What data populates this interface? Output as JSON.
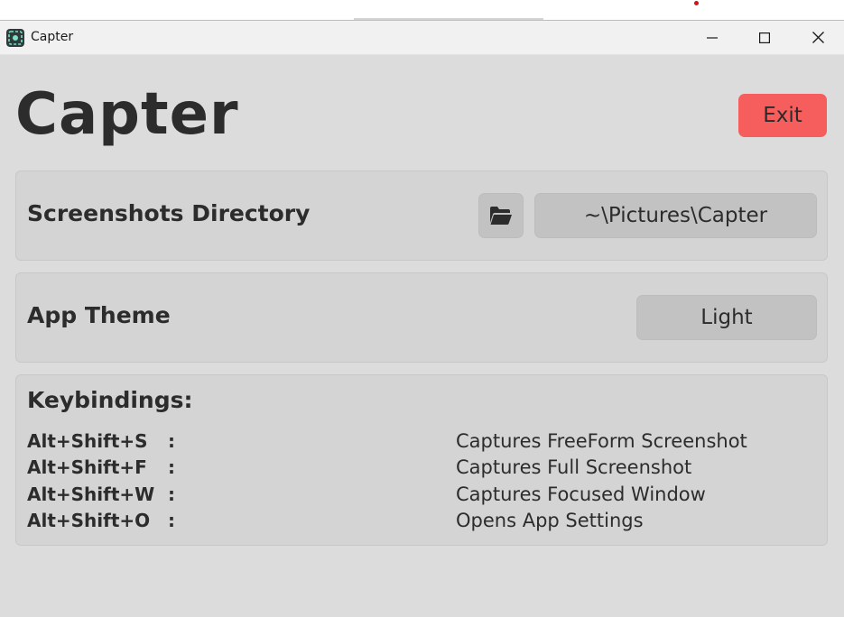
{
  "window": {
    "title": "Capter",
    "controls": {
      "minimize_icon": "minimize-icon",
      "maximize_icon": "maximize-icon",
      "close_icon": "close-icon"
    }
  },
  "header": {
    "title": "Capter",
    "exit_label": "Exit",
    "exit_color": "#f65d5d"
  },
  "directory": {
    "label": "Screenshots Directory",
    "browse_icon": "folder-open-icon",
    "path": "~\\Pictures\\Capter"
  },
  "theme": {
    "label": "App Theme",
    "value": "Light"
  },
  "keybindings": {
    "label": "Keybindings:",
    "items": [
      {
        "combo": "Alt+Shift+S",
        "separator": ":",
        "description": "Captures FreeForm Screenshot"
      },
      {
        "combo": "Alt+Shift+F",
        "separator": ":",
        "description": "Captures Full Screenshot"
      },
      {
        "combo": "Alt+Shift+W",
        "separator": ":",
        "description": "Captures Focused Window"
      },
      {
        "combo": "Alt+Shift+O",
        "separator": ":",
        "description": "Opens App Settings"
      }
    ]
  }
}
